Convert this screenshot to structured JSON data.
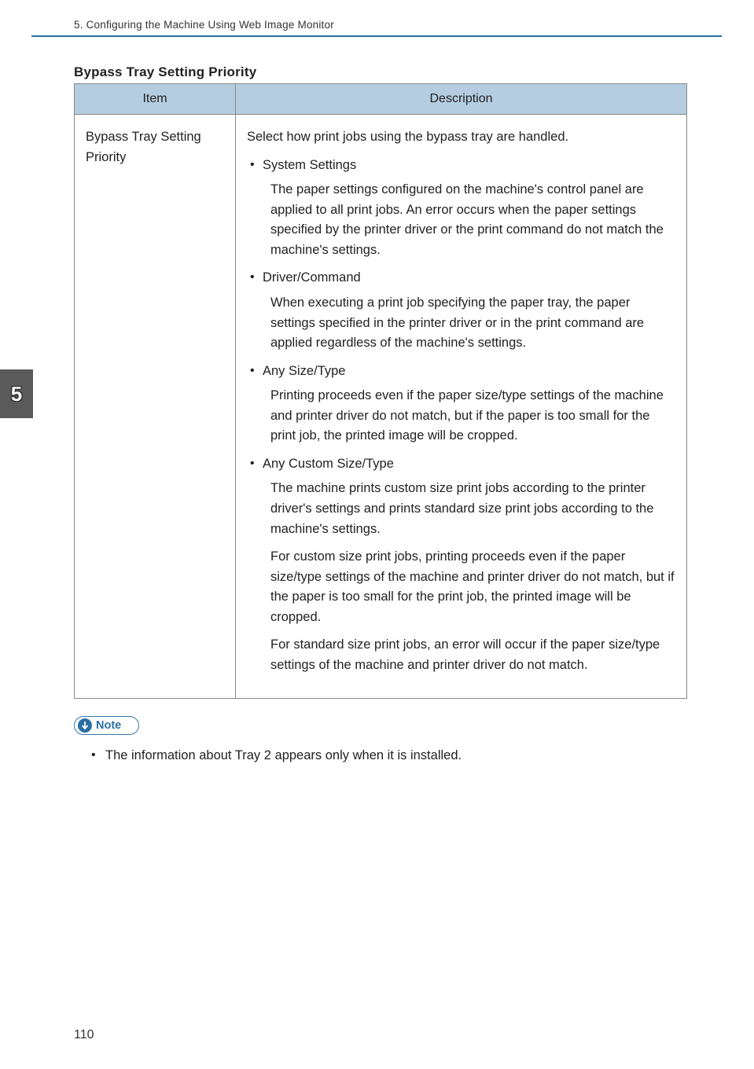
{
  "header": {
    "chapter_title": "5. Configuring the Machine Using Web Image Monitor"
  },
  "chapter_tab": "5",
  "table": {
    "caption": "Bypass Tray Setting Priority",
    "columns": {
      "item": "Item",
      "description": "Description"
    },
    "row": {
      "item": "Bypass Tray Setting Priority",
      "intro": "Select how print jobs using the bypass tray are handled.",
      "options": [
        {
          "title": "System Settings",
          "paras": [
            "The paper settings configured on the machine's control panel are applied to all print jobs. An error occurs when the paper settings specified by the printer driver or the print command do not match the machine's settings."
          ]
        },
        {
          "title": "Driver/Command",
          "paras": [
            "When executing a print job specifying the paper tray, the paper settings specified in the printer driver or in the print command are applied regardless of the machine's settings."
          ]
        },
        {
          "title": "Any Size/Type",
          "paras": [
            "Printing proceeds even if the paper size/type settings of the machine and printer driver do not match, but if the paper is too small for the print job, the printed image will be cropped."
          ]
        },
        {
          "title": "Any Custom Size/Type",
          "paras": [
            "The machine prints custom size print jobs according to the printer driver's settings and prints standard size print jobs according to the machine's settings.",
            "For custom size print jobs, printing proceeds even if the paper size/type settings of the machine and printer driver do not match, but if the paper is too small for the print job, the printed image will be cropped.",
            "For standard size print jobs, an error will occur if the paper size/type settings of the machine and printer driver do not match."
          ]
        }
      ]
    }
  },
  "note": {
    "label": "Note",
    "items": [
      "The information about Tray 2 appears only when it is installed."
    ]
  },
  "page_number": "110"
}
